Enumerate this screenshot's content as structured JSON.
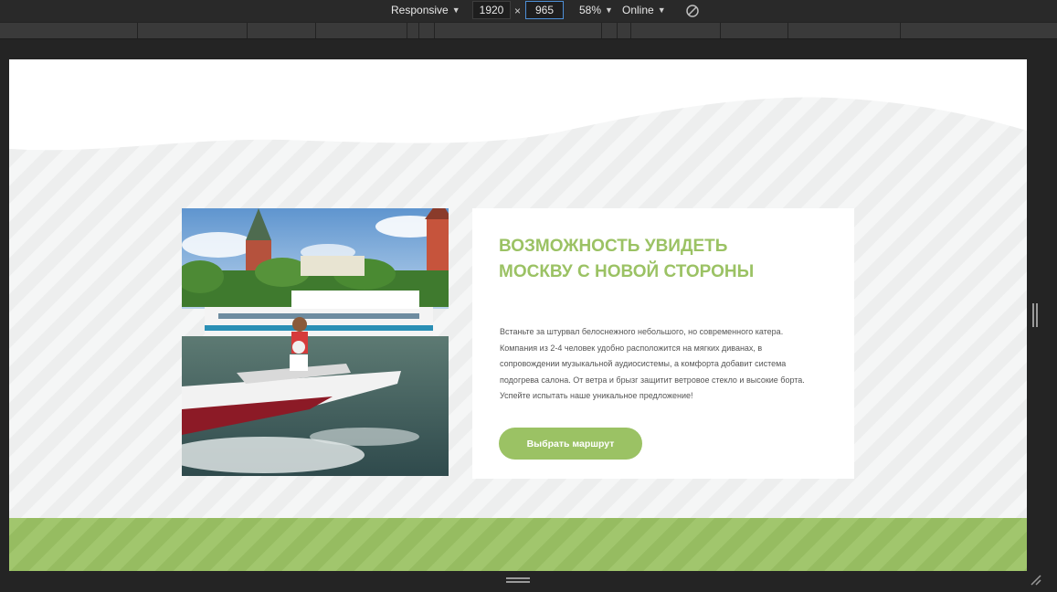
{
  "devtools": {
    "device_mode": "Responsive",
    "width_value": "1920",
    "times_symbol": "×",
    "height_value": "965",
    "zoom": "58%",
    "throttling": "Online",
    "rotate_icon": "rotate-icon"
  },
  "page": {
    "card": {
      "title": "Возможность увидеть Москву с новой стороны",
      "body": "Встаньте за штурвал белоснежного небольшого, но современного катера. Компания из 2-4 человек удобно расположится на мягких диванах, в сопровождении музыкальной аудиосистемы, а комфорта добавит система подогрева салона. От ветра и брызг защитит ветровое стекло и высокие борта. Успейте испытать наше уникальное предложение!",
      "button_label": "Выбрать маршрут"
    },
    "colors": {
      "accent": "#9bc264",
      "section_bg": "#f0f1f1",
      "card_bg": "#ffffff"
    }
  }
}
